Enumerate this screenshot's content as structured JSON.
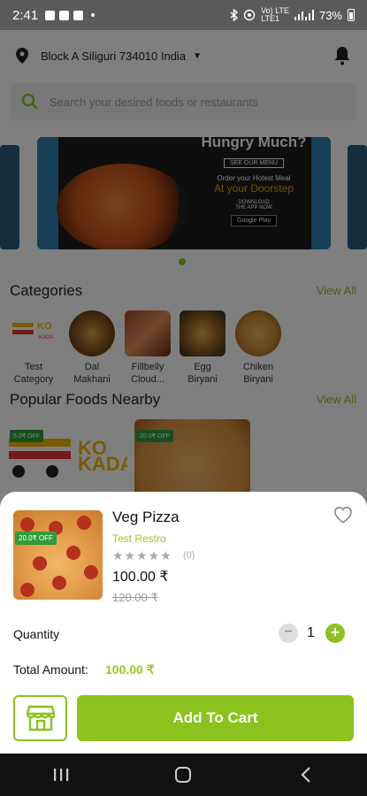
{
  "status_bar": {
    "time": "2:41",
    "network_small": "Vo) LTE\nLTE1",
    "battery": "73%"
  },
  "header": {
    "location": "Block A Siliguri 734010 India",
    "icons": [
      "location-pin-icon",
      "chevron-down-icon",
      "bell-icon"
    ]
  },
  "search": {
    "placeholder": "Search your desired foods or restaurants"
  },
  "banner": {
    "headline": "Hungry Much?",
    "menu_button": "SEE OUR MENU",
    "line1": "Order your Hotest Meal",
    "line2": "At your Doorstep",
    "download": "DOWNLOAD\nTHE APP NOW",
    "store": "Google Play"
  },
  "categories": {
    "title": "Categories",
    "view_all": "View All",
    "items": [
      {
        "label": "Test\nCategory"
      },
      {
        "label": "Dal\nMakhani"
      },
      {
        "label": "Fillbelly\nCloud..."
      },
      {
        "label": "Egg\nBiryani"
      },
      {
        "label": "Chiken\nBiryani"
      }
    ]
  },
  "popular": {
    "title": "Popular Foods Nearby",
    "view_all": "View All",
    "cards": [
      {
        "badge": "5.0₹ OFF",
        "brand": "KO\nKADAIY"
      },
      {
        "badge": "20.0₹ OFF"
      }
    ]
  },
  "product": {
    "name": "Veg Pizza",
    "restaurant": "Test Restro",
    "stars": "★★★★★",
    "rating_count": "(0)",
    "price": "100.00 ₹",
    "old_price": "120.00 ₹",
    "badge": "20.0₹ OFF"
  },
  "quantity": {
    "label": "Quantity",
    "value": "1",
    "minus": "−",
    "plus": "+"
  },
  "total": {
    "label": "Total Amount:",
    "value": "100.00 ₹"
  },
  "actions": {
    "add_to_cart": "Add To Cart"
  },
  "colors": {
    "accent": "#8bc21e",
    "badge": "#2f9c3d"
  }
}
